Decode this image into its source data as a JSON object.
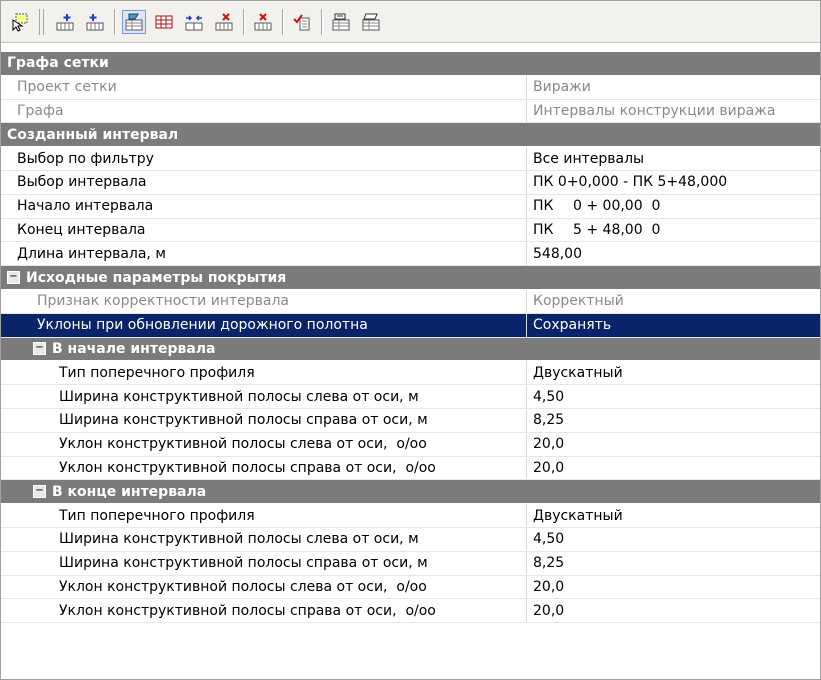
{
  "toolbar": {
    "buttons": [
      {
        "icon": "select-icon"
      },
      {
        "icon": "add-row-before-icon"
      },
      {
        "icon": "add-row-after-icon"
      },
      {
        "icon": "properties-icon",
        "pressed": true
      },
      {
        "icon": "table-icon"
      },
      {
        "icon": "split-interval-icon"
      },
      {
        "icon": "delete-interval-icon"
      },
      {
        "icon": "delete-all-icon"
      },
      {
        "icon": "check-list-icon"
      },
      {
        "icon": "export-icon"
      },
      {
        "icon": "import-icon"
      }
    ]
  },
  "grid": {
    "cat_grafa": "Графа сетки",
    "project_label": "Проект сетки",
    "project_value": "Виражи",
    "grafa_label": "Графа",
    "grafa_value": "Интервалы конструкции виража",
    "cat_interval": "Созданный интервал",
    "filter_label": "Выбор по фильтру",
    "filter_value": "Все интервалы",
    "interval_label": "Выбор интервала",
    "interval_value": "ПК 0+0,000 - ПК 5+48,000",
    "start_label": "Начало интервала",
    "start_pk": "ПК",
    "start_value": "0 + 00,00  0",
    "end_label": "Конец интервала",
    "end_pk": "ПК",
    "end_value": "5 + 48,00  0",
    "length_label": "Длина интервала, м",
    "length_value": "548,00",
    "cat_params": "Исходные параметры покрытия",
    "correct_label": "Признак корректности интервала",
    "correct_value": "Корректный",
    "slopes_label": "Уклоны при обновлении дорожного полотна",
    "slopes_value": "Сохранять",
    "cat_start": "В начале интервала",
    "cat_end": "В конце интервала",
    "start_block": {
      "profile_label": "Тип поперечного профиля",
      "profile_value": "Двускатный",
      "wl_label": "Ширина конструктивной полосы слева от оси, м",
      "wl_value": "4,50",
      "wr_label": "Ширина конструктивной полосы справа от оси, м",
      "wr_value": "8,25",
      "sl_label": "Уклон конструктивной полосы слева от оси,  о/оо",
      "sl_value": "20,0",
      "sr_label": "Уклон конструктивной полосы справа от оси,  о/оо",
      "sr_value": "20,0"
    },
    "end_block": {
      "profile_label": "Тип поперечного профиля",
      "profile_value": "Двускатный",
      "wl_label": "Ширина конструктивной полосы слева от оси, м",
      "wl_value": "4,50",
      "wr_label": "Ширина конструктивной полосы справа от оси, м",
      "wr_value": "8,25",
      "sl_label": "Уклон конструктивной полосы слева от оси,  о/оо",
      "sl_value": "20,0",
      "sr_label": "Уклон конструктивной полосы справа от оси,  о/оо",
      "sr_value": "20,0"
    },
    "expand_symbol": "−"
  }
}
